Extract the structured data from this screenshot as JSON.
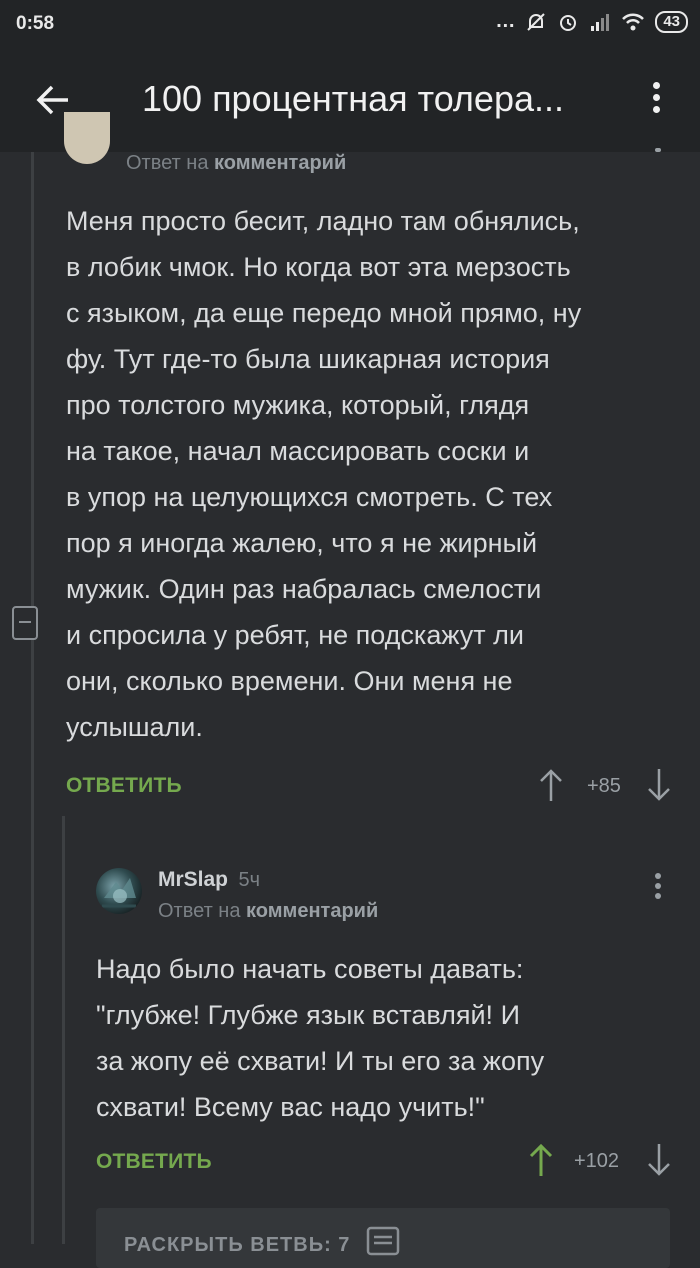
{
  "status_bar": {
    "time": "0:58",
    "battery": "43"
  },
  "header": {
    "title": "100 процентная толера..."
  },
  "comment1": {
    "reply_prefix": "Ответ на",
    "reply_target": "комментарий",
    "text": "Меня просто бесит, ладно там обнялись, в лобик чмок. Но когда вот эта мерзость с языком, да еще передо мной прямо, ну фу. Тут где-то была шикарная история про толстого мужика, который, глядя на такое, начал массировать соски и в упор на целующихся смотреть. С тех пор я иногда жалею, что я не жирный мужик. Один раз набралась смелости и спросила у ребят, не подскажут ли они, сколько времени. Они меня не услышали.",
    "lines": [
      "Меня просто бесит, ладно там обнялись,",
      "в лобик чмок. Но когда вот эта мерзость",
      "с языком, да еще передо мной прямо, ну",
      "фу. Тут где-то была шикарная история",
      "про толстого мужика, который, глядя",
      "на такое, начал массировать соски и",
      "в упор на целующихся смотреть. С тех",
      "пор я иногда жалею, что я не жирный",
      "мужик. Один раз набралась смелости",
      "и спросила у ребят, не подскажут ли",
      "они, сколько времени. Они меня не",
      "услышали."
    ],
    "reply_label": "ОТВЕТИТЬ",
    "rating": "+85"
  },
  "comment2": {
    "username": "MrSlap",
    "time_ago": "5ч",
    "reply_prefix": "Ответ на",
    "reply_target": "комментарий",
    "lines": [
      "Надо было начать советы давать:",
      "\"глубже! Глубже язык вставляй! И",
      "за жопу её схвати! И ты его за жопу",
      "схвати! Всему вас надо учить!\""
    ],
    "reply_label": "ОТВЕТИТЬ",
    "rating": "+102"
  },
  "expand_thread": {
    "label": "РАСКРЫТЬ ВЕТВЬ: 7"
  },
  "colors": {
    "background": "#2a2c2f",
    "bar": "#222426",
    "accent_green": "#75a94e"
  }
}
